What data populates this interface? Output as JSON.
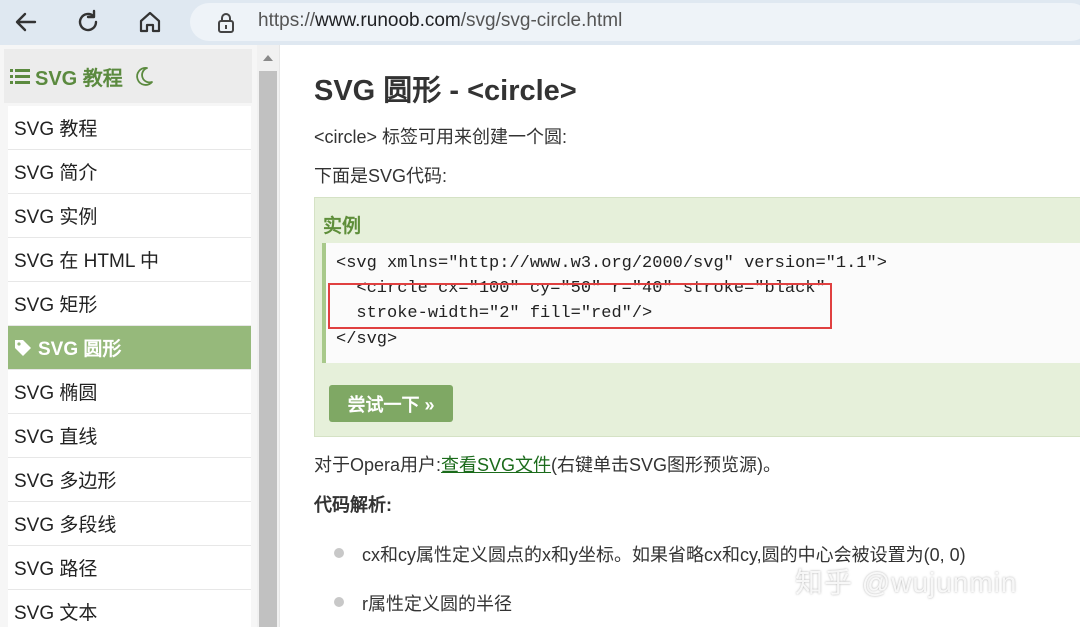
{
  "browser": {
    "url_prefix": "https://",
    "url_host": "www.runoob.com",
    "url_path": "/svg/svg-circle.html"
  },
  "sidebar": {
    "title": "SVG 教程",
    "items": [
      {
        "label": "SVG 教程"
      },
      {
        "label": "SVG 简介"
      },
      {
        "label": "SVG 实例"
      },
      {
        "label": "SVG 在 HTML 中"
      },
      {
        "label": "SVG 矩形"
      },
      {
        "label": "SVG 圆形",
        "active": true
      },
      {
        "label": "SVG 椭圆"
      },
      {
        "label": "SVG 直线"
      },
      {
        "label": "SVG 多边形"
      },
      {
        "label": "SVG 多段线"
      },
      {
        "label": "SVG 路径"
      },
      {
        "label": "SVG 文本"
      }
    ]
  },
  "main": {
    "title": "SVG 圆形 - <circle>",
    "intro": "<circle> 标签可用来创建一个圆:",
    "code_intro": "下面是SVG代码:",
    "example": {
      "heading": "实例",
      "code_lines": [
        "<svg xmlns=\"http://www.w3.org/2000/svg\" version=\"1.1\">",
        "  <circle cx=\"100\" cy=\"50\" r=\"40\" stroke=\"black\"",
        "  stroke-width=\"2\" fill=\"red\"/>",
        "</svg>"
      ],
      "try_button": "尝试一下 »"
    },
    "opera_prefix": "对于Opera用户:",
    "opera_link": "查看SVG文件",
    "opera_suffix": "(右键单击SVG图形预览源)。",
    "analysis_heading": "代码解析:",
    "bullets": [
      "cx和cy属性定义圆点的x和y坐标。如果省略cx和cy,圆的中心会被设置为(0, 0)",
      "r属性定义圆的半径"
    ]
  },
  "watermark": "知乎 @wujunmin",
  "colors": {
    "accent_green": "#96b97b",
    "title_green": "#5e8e3a",
    "highlight_red": "#e04040"
  }
}
